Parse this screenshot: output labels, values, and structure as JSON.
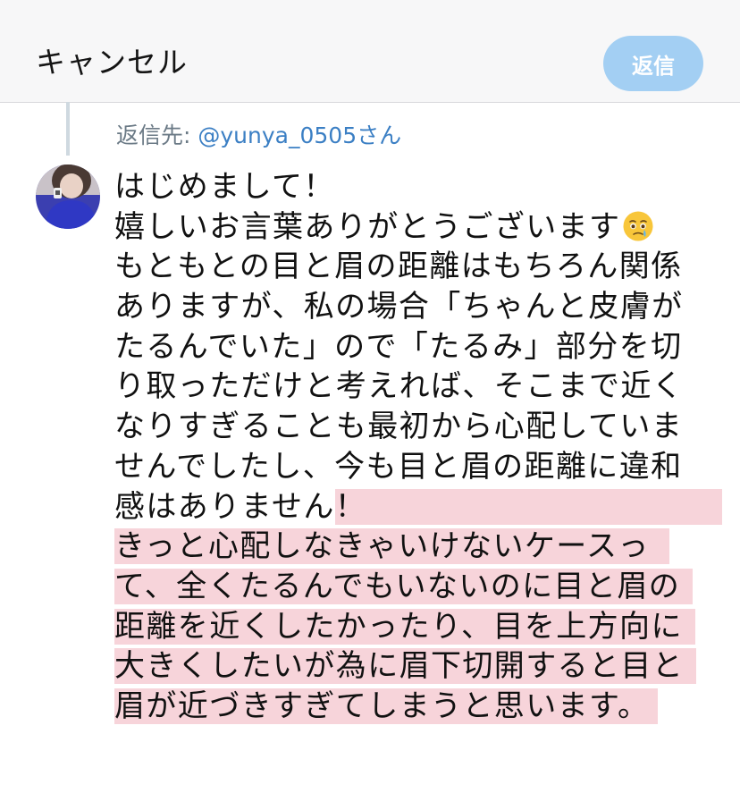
{
  "header": {
    "cancel_label": "キャンセル",
    "reply_label": "返信",
    "reply_button_color": "#a3cff3"
  },
  "reply_to": {
    "prefix": "返信先: ",
    "handle": "@yunya_0505さん"
  },
  "avatar": {
    "icon": "user-avatar-photo"
  },
  "tweet": {
    "lines": [
      "はじめまして！",
      "嬉しいお言葉ありがとうございます",
      "もともとの目と眉の距離はもちろん関係",
      "ありますが、私の場合「ちゃんと皮膚が",
      "たるんでいた」ので「たるみ」部分を切",
      "り取っただけと考えれば、そこまで近く",
      "なりすぎることも最初から心配していま",
      "せんでしたし、今も目と眉の距離に違和"
    ],
    "partial_line_plain": "感はありません",
    "partial_line_highlighted": "！",
    "highlighted_lines": [
      "きっと心配しなきゃいけないケースっ",
      "て、全くたるんでもいないのに目と眉の",
      "距離を近くしたかったり、目を上方向に",
      "大きくしたいが為に眉下切開すると目と",
      "眉が近づきすぎてしまうと思います。"
    ],
    "emoji": "face-holding-back-tears-emoji",
    "highlight_color": "#f7d4da"
  }
}
